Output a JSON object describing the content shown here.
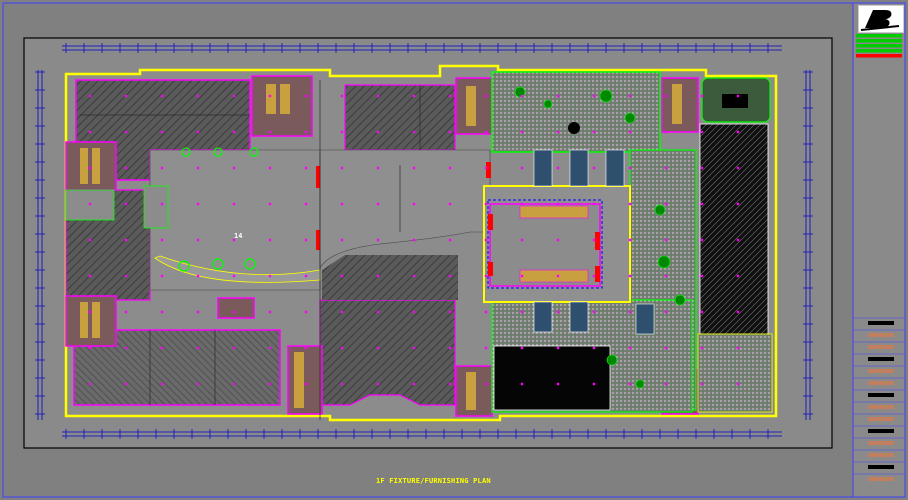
{
  "drawing": {
    "plan_title": "1F FIXTURE/FURNISHING PLAN",
    "center_label": "14",
    "footer_note": "",
    "brand_text": "B"
  },
  "colors": {
    "background": "#808080",
    "frame": "#000000",
    "wall_magenta": "#ff00ff",
    "boundary_yellow": "#ffff00",
    "boundary_green": "#00ff00",
    "grid_blue": "#4040ff",
    "hatch_dark": "#505050",
    "garden_green": "#00aa00",
    "accent_red": "#ff0000",
    "dim_line": "#0000ff",
    "title_yellow": "#ffff00"
  },
  "legend_bars": [
    "#00cc00",
    "#00cc00",
    "#00cc00",
    "#00cc00",
    "#ff0000"
  ],
  "title_block_rows": 14
}
